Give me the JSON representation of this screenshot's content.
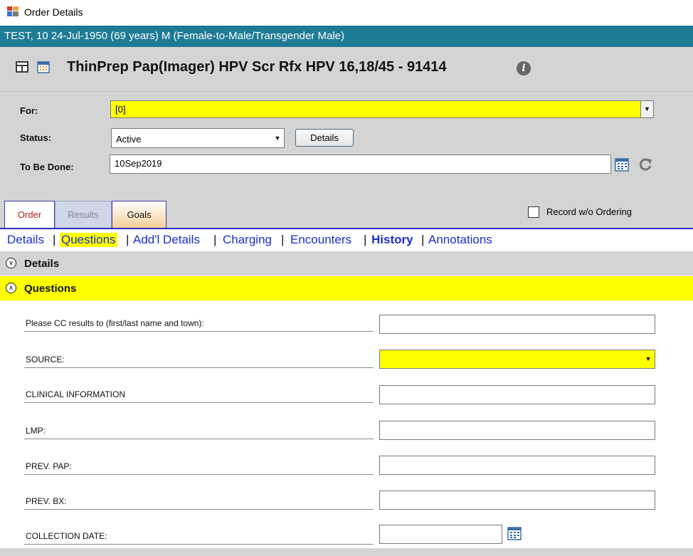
{
  "window": {
    "title": "Order Details",
    "icon": "app-window-icon"
  },
  "patient": {
    "summary": "TEST, 10   24-Jul-1950  (69 years)  M (Female-to-Male/Transgender Male)"
  },
  "order": {
    "title": "ThinPrep Pap(Imager) HPV Scr Rfx HPV 16,18/45 - 91414",
    "icons": [
      "grid-view-icon",
      "calendar-icon",
      "info-icon"
    ]
  },
  "form": {
    "for_label": "For:",
    "for_value": "[0]",
    "status_label": "Status:",
    "status_value": "Active",
    "details_button": "Details",
    "to_be_done_label": "To Be Done:",
    "to_be_done_value": "10Sep2019"
  },
  "tabs": [
    {
      "label": "Order",
      "active": true
    },
    {
      "label": "Results",
      "active": false
    },
    {
      "label": "Goals",
      "active": false
    }
  ],
  "record_without_ordering": {
    "label": "Record w/o Ordering",
    "checked": false
  },
  "subnav": {
    "items": [
      {
        "label": "Details"
      },
      {
        "label": "Questions",
        "active": true
      },
      {
        "label": "Add'l Details"
      },
      {
        "label": "Charging"
      },
      {
        "label": "Encounters"
      },
      {
        "label": "History",
        "bold": true
      },
      {
        "label": "Annotations"
      }
    ]
  },
  "sections": {
    "details": {
      "label": "Details",
      "expanded": false
    },
    "questions": {
      "label": "Questions",
      "expanded": true
    }
  },
  "questions": [
    {
      "label": "Please CC results to (first/last name and town):",
      "value": ""
    },
    {
      "label": "SOURCE:",
      "value": "",
      "type": "dropdown"
    },
    {
      "label": "CLINICAL INFORMATION",
      "value": ""
    },
    {
      "label": "LMP:",
      "value": ""
    },
    {
      "label": "PREV. PAP:",
      "value": ""
    },
    {
      "label": "PREV. BX:",
      "value": ""
    },
    {
      "label": "COLLECTION DATE:",
      "value": "",
      "type": "date"
    }
  ],
  "colors": {
    "patient_bar": "#1e7b96",
    "highlight_yellow": "#ffff00",
    "panel_gray": "#d4d4d4",
    "link_blue": "#1a2fd0"
  }
}
